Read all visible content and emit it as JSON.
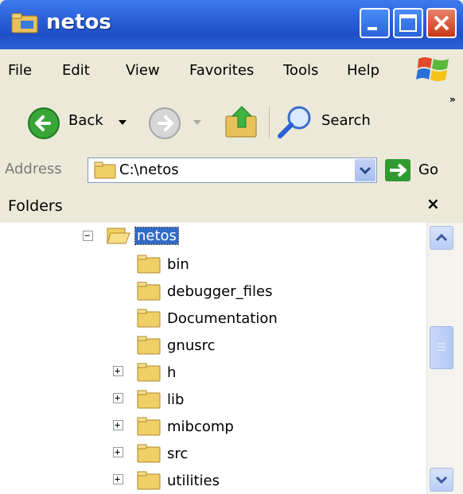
{
  "window": {
    "title": "netos"
  },
  "menu": {
    "items": [
      "File",
      "Edit",
      "View",
      "Favorites",
      "Tools",
      "Help"
    ]
  },
  "toolbar": {
    "back_label": "Back",
    "search_label": "Search",
    "overflow": "»"
  },
  "address": {
    "label": "Address",
    "value": "C:\\netos",
    "go_label": "Go"
  },
  "folders_pane": {
    "title": "Folders",
    "close": "×"
  },
  "tree": {
    "root": {
      "label": "netos",
      "expander": "−"
    },
    "children": [
      {
        "label": "bin",
        "expander": ""
      },
      {
        "label": "debugger_files",
        "expander": ""
      },
      {
        "label": "Documentation",
        "expander": ""
      },
      {
        "label": "gnusrc",
        "expander": ""
      },
      {
        "label": "h",
        "expander": "+"
      },
      {
        "label": "lib",
        "expander": "+"
      },
      {
        "label": "mibcomp",
        "expander": "+"
      },
      {
        "label": "src",
        "expander": "+"
      },
      {
        "label": "utilities",
        "expander": "+"
      }
    ]
  },
  "colors": {
    "titlebar": "#2a5fd8",
    "selection": "#316ac5",
    "go": "#2f9a2f"
  }
}
